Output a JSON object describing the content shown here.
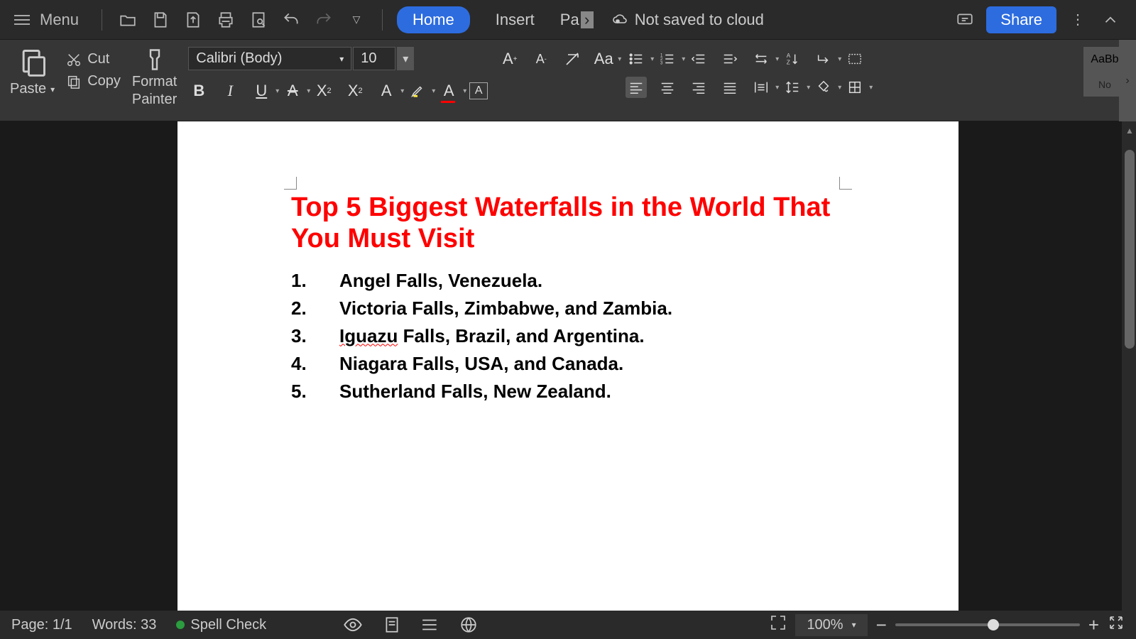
{
  "topbar": {
    "menu": "Menu",
    "tabs": {
      "home": "Home",
      "insert": "Insert",
      "truncated": "Pa"
    },
    "cloud_status": "Not saved to cloud",
    "share": "Share"
  },
  "ribbon": {
    "paste": "Paste",
    "cut": "Cut",
    "copy": "Copy",
    "format_painter_l1": "Format",
    "format_painter_l2": "Painter",
    "font_name": "Calibri (Body)",
    "font_size": "10",
    "style_preview": "AaBb",
    "style_name": "No"
  },
  "document": {
    "title": "Top 5 Biggest Waterfalls in the World That You Must Visit",
    "items": [
      {
        "num": "1.",
        "text_pre": "Angel Falls, Venezuela."
      },
      {
        "num": "2.",
        "text_pre": "Victoria Falls, Zimbabwe, and Zambia."
      },
      {
        "num": "3.",
        "spell": "Iguazu",
        "text_post": " Falls, Brazil, and Argentina."
      },
      {
        "num": "4.",
        "text_pre": "Niagara Falls, USA, and Canada."
      },
      {
        "num": "5.",
        "text_pre": "Sutherland Falls, New Zealand."
      }
    ]
  },
  "status": {
    "page": "Page: 1/1",
    "words": "Words: 33",
    "spell": "Spell Check",
    "zoom": "100%"
  }
}
